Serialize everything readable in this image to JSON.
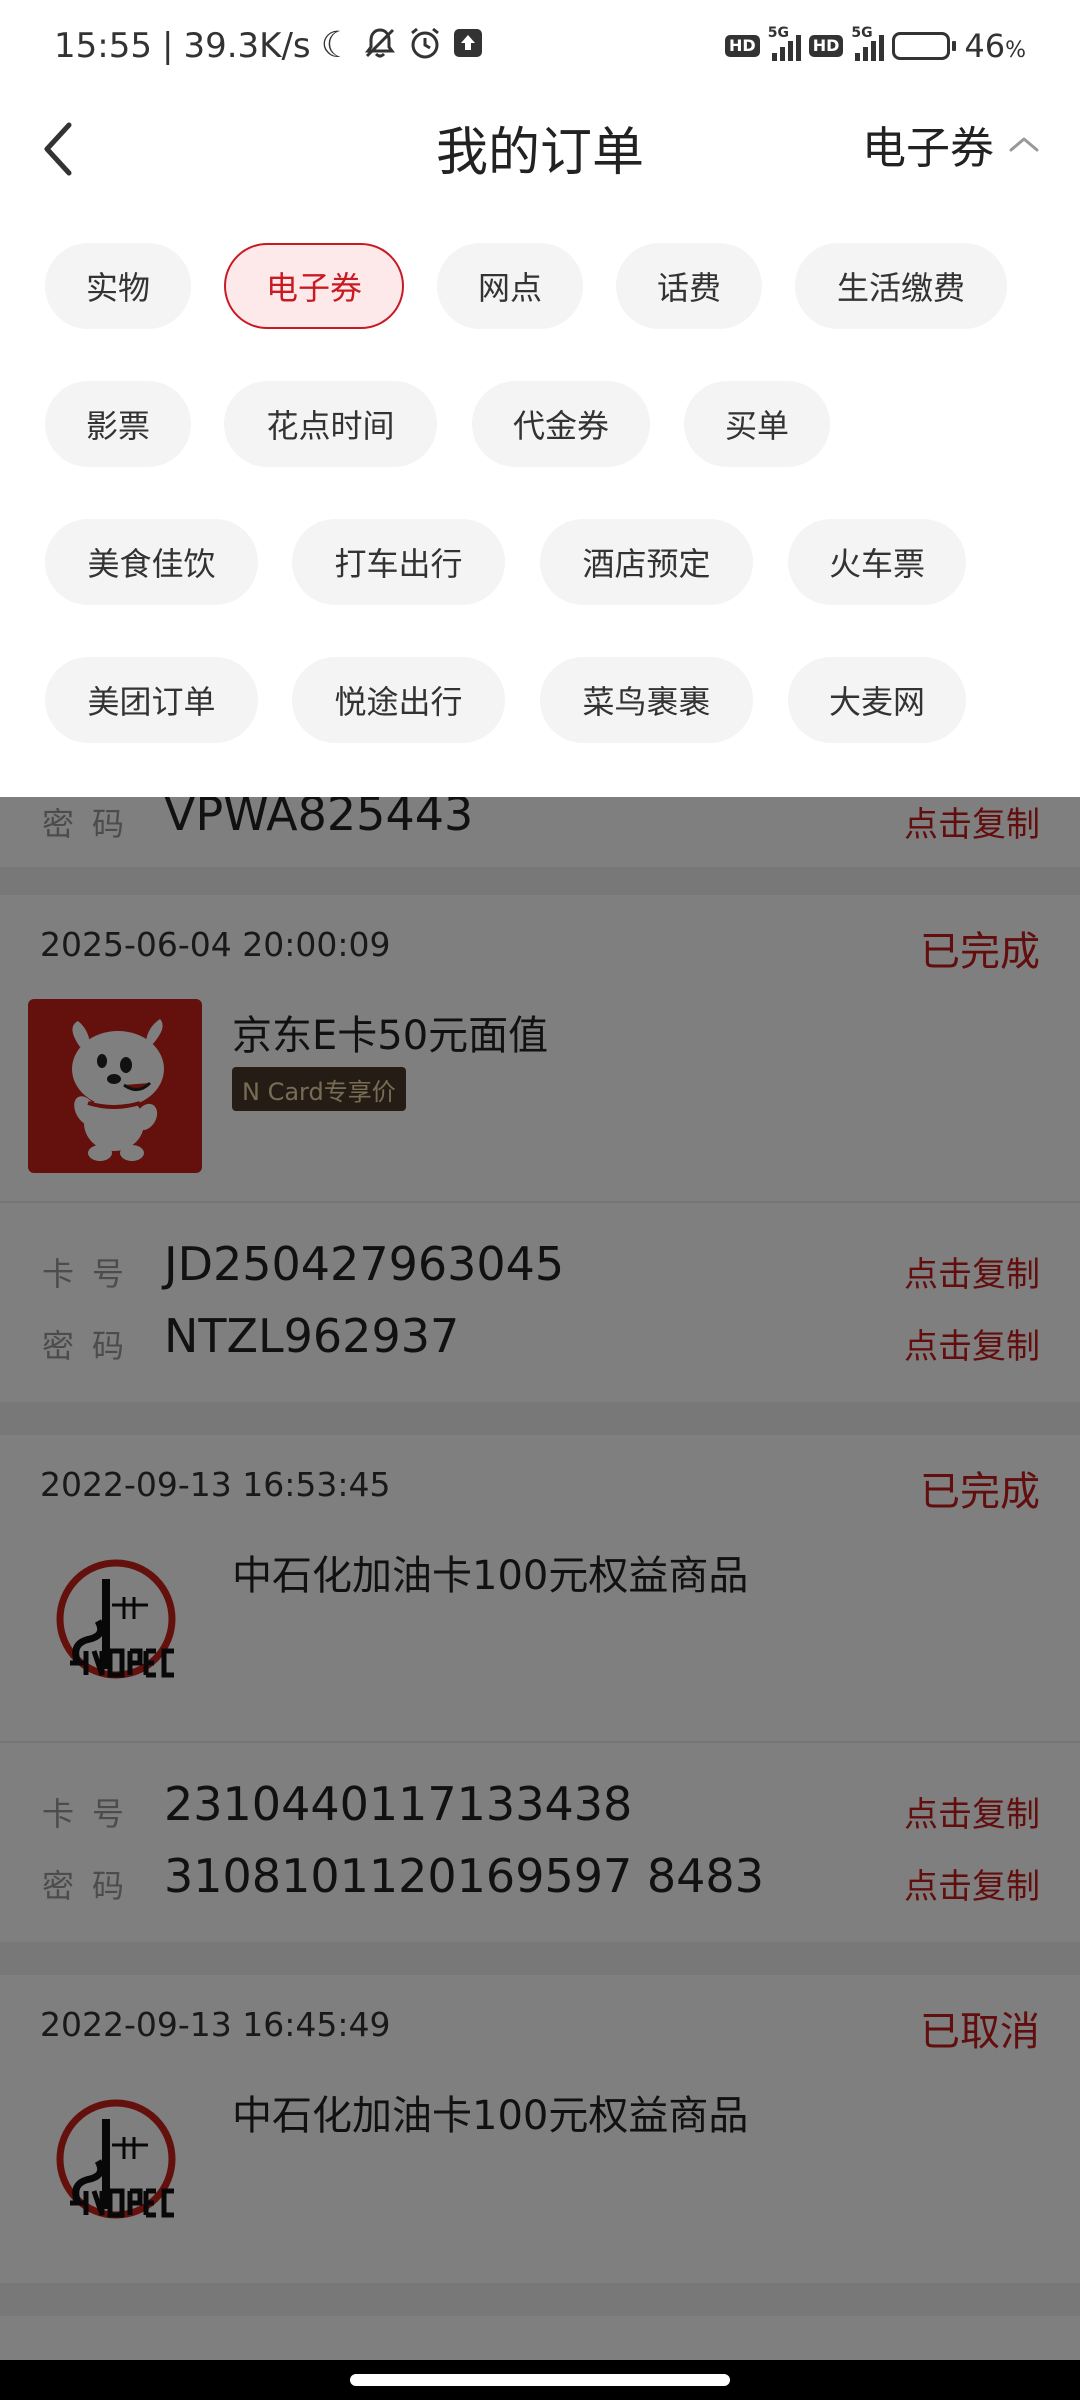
{
  "status_bar": {
    "time": "15:55",
    "separator": "|",
    "net_speed": "39.3K/s",
    "battery_pct": "46",
    "battery_unit": "%",
    "battery_level": 0.46,
    "hd_label": "HD",
    "net_type": "5G"
  },
  "header": {
    "title": "我的订单",
    "filter_label": "电子券"
  },
  "categories": [
    "实物",
    "电子券",
    "网点",
    "话费",
    "生活缴费",
    "影票",
    "花点时间",
    "代金券",
    "买单",
    "美食佳饮",
    "打车出行",
    "酒店预定",
    "火车票",
    "美团订单",
    "悦途出行",
    "菜鸟裹裹",
    "大麦网"
  ],
  "selected_category": "电子券",
  "labels": {
    "card_no": "卡号",
    "password": "密码",
    "copy": "点击复制"
  },
  "partial_top": {
    "password": "VPWA825443"
  },
  "orders": [
    {
      "time": "2025-06-04 20:00:09",
      "status": "已完成",
      "name": "京东E卡50元面值",
      "badge": "N Card专享价",
      "card_no": "JD250427963045",
      "password": "NTZL962937"
    },
    {
      "time": "2022-09-13 16:53:45",
      "status": "已完成",
      "name": "中石化加油卡100元权益商品",
      "card_no": "2310440117133438",
      "password": "3108101120169597 8483"
    },
    {
      "time": "2022-09-13 16:45:49",
      "status": "已取消",
      "name": "中石化加油卡100元权益商品"
    }
  ],
  "colors": {
    "accent": "#c91a24",
    "status_red": "#c41c1c",
    "badge_bg": "#4b3a2b",
    "jd_red": "#c8201a"
  }
}
